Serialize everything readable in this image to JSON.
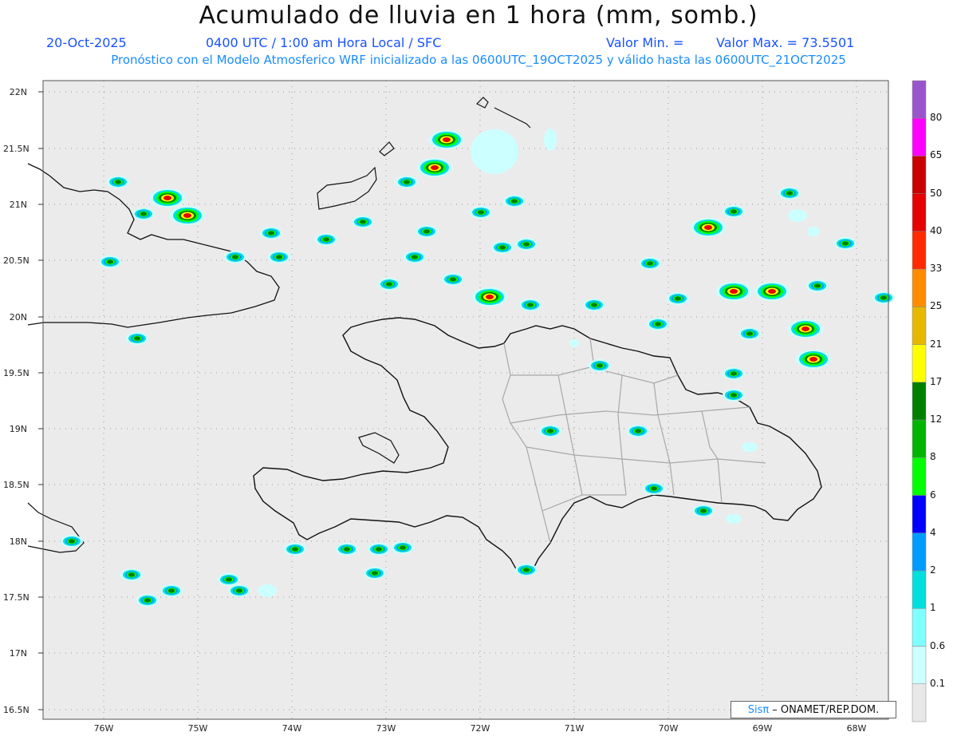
{
  "title": "Acumulado de lluvia en 1 hora (mm, somb.)",
  "date": "20-Oct-2025",
  "time": "0400 UTC / 1:00 am Hora Local / SFC",
  "valmin_label": "Valor Min. =",
  "valmax_label": "Valor Max. = 73.5501",
  "forecast_line": "Pronóstico con el Modelo Atmosferico WRF inicializado a las 0600UTC_19OCT2025 y válido hasta las  0600UTC_21OCT2025",
  "lat_labels": [
    "22N",
    "21.5N",
    "21N",
    "20.5N",
    "20N",
    "19.5N",
    "19N",
    "18.5N",
    "18N",
    "17.5N",
    "17N",
    "16.5N"
  ],
  "lon_labels": [
    "76W",
    "75W",
    "74W",
    "73W",
    "72W",
    "71W",
    "70W",
    "69W",
    "68W"
  ],
  "colorbar": {
    "labels": [
      "80",
      "65",
      "50",
      "40",
      "33",
      "25",
      "21",
      "17",
      "12",
      "8",
      "6",
      "4",
      "2",
      "1",
      "0.6",
      "0.1"
    ],
    "colors": [
      "#9a55cc",
      "#ff00ff",
      "#c80000",
      "#e60000",
      "#ff2a00",
      "#ff8c00",
      "#e6b800",
      "#ffff00",
      "#007f00",
      "#00b400",
      "#00ff00",
      "#0000ff",
      "#009bff",
      "#00dede",
      "#7fffff",
      "#ccffff",
      "#e8e8e8"
    ]
  },
  "credit": {
    "brand": "Sisπ",
    "text": "– ONAMET/REP.DOM."
  }
}
